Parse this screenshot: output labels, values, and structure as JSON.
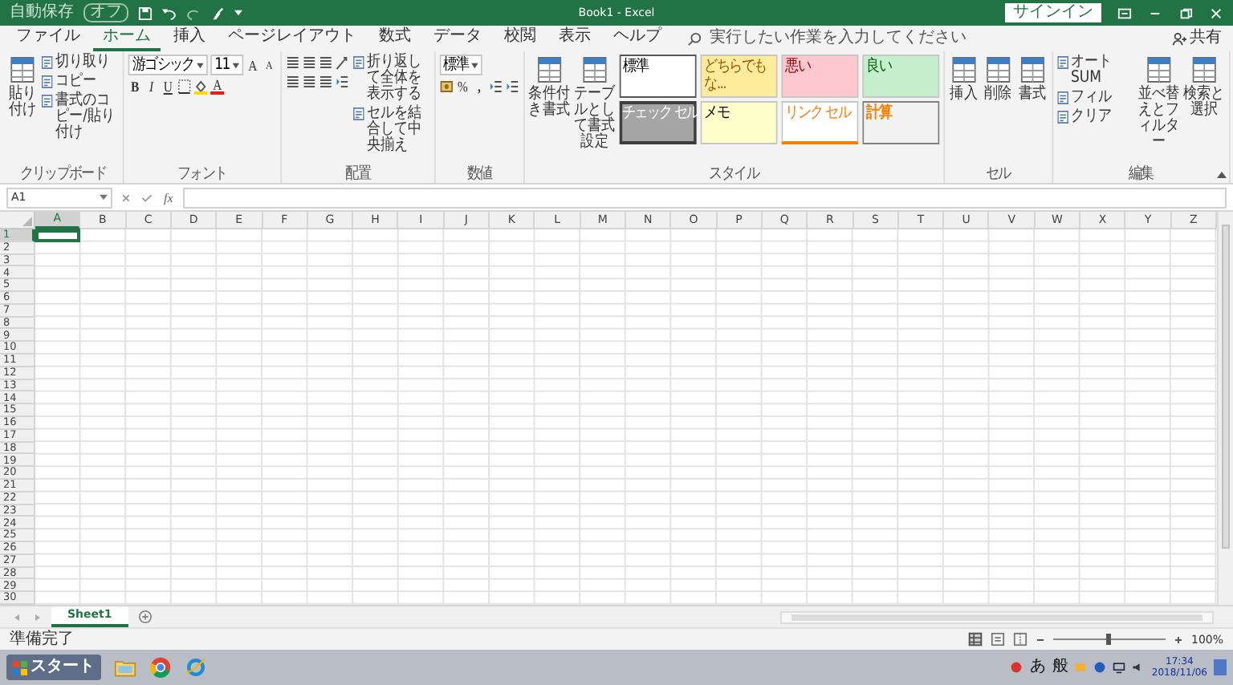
{
  "title_bar": {
    "autosave": "自動保存",
    "autosave_state": "オフ",
    "title": "Book1 - Excel",
    "signin": "サインイン"
  },
  "tabs": [
    {
      "label": "ファイル",
      "selected": false
    },
    {
      "label": "ホーム",
      "selected": true
    },
    {
      "label": "挿入",
      "selected": false
    },
    {
      "label": "ページレイアウト",
      "selected": false
    },
    {
      "label": "数式",
      "selected": false
    },
    {
      "label": "データ",
      "selected": false
    },
    {
      "label": "校閲",
      "selected": false
    },
    {
      "label": "表示",
      "selected": false
    },
    {
      "label": "ヘルプ",
      "selected": false
    }
  ],
  "tell_me": "実行したい作業を入力してください",
  "share": "共有",
  "ribbon": {
    "groups": [
      {
        "label": "クリップボード",
        "columns": [
          [
            [
              {
                "kind": "large",
                "label": "貼り付け"
              }
            ]
          ],
          [
            [
              {
                "kind": "small",
                "label": "切り取り"
              }
            ],
            [
              {
                "kind": "small",
                "label": "コピー"
              }
            ],
            [
              {
                "kind": "small",
                "label": "書式のコピー/貼り付け"
              }
            ]
          ]
        ]
      },
      {
        "label": "フォント",
        "columns": [
          [
            [
              {
                "kind": "field",
                "value": "游ゴシック"
              },
              {
                "kind": "field",
                "value": "11"
              },
              {
                "kind": "grow",
                "text": "A"
              },
              {
                "kind": "shrink",
                "text": "A"
              }
            ],
            [
              {
                "kind": "bold",
                "text": "B"
              },
              {
                "kind": "italic",
                "text": "I"
              },
              {
                "kind": "underline",
                "text": "U"
              },
              {
                "kind": "border"
              },
              {
                "kind": "fill"
              },
              {
                "kind": "fontcolor",
                "text": "A"
              }
            ]
          ]
        ]
      },
      {
        "label": "配置",
        "columns": [
          [
            [
              {
                "kind": "align"
              },
              {
                "kind": "align"
              },
              {
                "kind": "align"
              },
              {
                "kind": "orient"
              }
            ],
            [
              {
                "kind": "align"
              },
              {
                "kind": "align"
              },
              {
                "kind": "align"
              },
              {
                "kind": "indent"
              }
            ]
          ],
          [
            [
              {
                "kind": "small",
                "label": "折り返して全体を表示する"
              }
            ],
            [
              {
                "kind": "small",
                "label": "セルを結合して中央揃え"
              }
            ]
          ]
        ]
      },
      {
        "label": "数値",
        "columns": [
          [
            [
              {
                "kind": "field",
                "value": "標準"
              }
            ],
            [
              {
                "kind": "currency"
              },
              {
                "kind": "percent",
                "text": "%"
              },
              {
                "kind": "comma",
                "text": ","
              },
              {
                "kind": "indent"
              },
              {
                "kind": "indent"
              }
            ]
          ]
        ]
      },
      {
        "label": "スタイル",
        "columns": [
          [
            [
              {
                "kind": "large",
                "label": "条件付き書式"
              }
            ]
          ],
          [
            [
              {
                "kind": "large",
                "label": "テーブルとして書式設定"
              }
            ]
          ],
          [
            [
              {
                "kind": "normal",
                "label": "標準",
                "color": "#ffffff"
              }
            ],
            [
              {
                "kind": "check",
                "label": "チェック セル",
                "color": "#a5a5a5"
              }
            ]
          ],
          [
            [
              {
                "kind": "neutral",
                "label": "どちらでもな...",
                "color": "#ffeb9c"
              }
            ],
            [
              {
                "kind": "note",
                "label": "メモ",
                "color": "#ffffcc"
              }
            ]
          ],
          [
            [
              {
                "kind": "bad",
                "label": "悪い",
                "color": "#ffc7ce"
              }
            ],
            [
              {
                "kind": "link",
                "label": "リンク セル",
                "color": "#ffffff"
              }
            ]
          ],
          [
            [
              {
                "kind": "good",
                "label": "良い",
                "color": "#c6efce"
              }
            ],
            [
              {
                "kind": "calc",
                "label": "計算",
                "color": "#f2f2f2"
              }
            ]
          ]
        ]
      },
      {
        "label": "セル",
        "columns": [
          [
            [
              {
                "kind": "large",
                "label": "挿入"
              }
            ]
          ],
          [
            [
              {
                "kind": "large",
                "label": "削除"
              }
            ]
          ],
          [
            [
              {
                "kind": "large",
                "label": "書式"
              }
            ]
          ]
        ]
      },
      {
        "label": "編集",
        "columns": [
          [
            [
              {
                "kind": "small",
                "label": "オート SUM"
              }
            ],
            [
              {
                "kind": "small",
                "label": "フィル"
              }
            ],
            [
              {
                "kind": "small",
                "label": "クリア"
              }
            ]
          ],
          [
            [
              {
                "kind": "large",
                "label": "並べ替えとフィルター"
              }
            ]
          ],
          [
            [
              {
                "kind": "large",
                "label": "検索と選択"
              }
            ]
          ]
        ]
      }
    ]
  },
  "formula_bar": {
    "name_box": "A1",
    "function_label": "fx"
  },
  "columns": [
    {
      "label": "A",
      "selected": true
    },
    {
      "label": "B",
      "selected": false
    },
    {
      "label": "C",
      "selected": false
    },
    {
      "label": "D",
      "selected": false
    },
    {
      "label": "E",
      "selected": false
    },
    {
      "label": "F",
      "selected": false
    },
    {
      "label": "G",
      "selected": false
    },
    {
      "label": "H",
      "selected": false
    },
    {
      "label": "I",
      "selected": false
    },
    {
      "label": "J",
      "selected": false
    },
    {
      "label": "K",
      "selected": false
    },
    {
      "label": "L",
      "selected": false
    },
    {
      "label": "M",
      "selected": false
    },
    {
      "label": "N",
      "selected": false
    },
    {
      "label": "O",
      "selected": false
    },
    {
      "label": "P",
      "selected": false
    },
    {
      "label": "Q",
      "selected": false
    },
    {
      "label": "R",
      "selected": false
    },
    {
      "label": "S",
      "selected": false
    },
    {
      "label": "T",
      "selected": false
    },
    {
      "label": "U",
      "selected": false
    },
    {
      "label": "V",
      "selected": false
    },
    {
      "label": "W",
      "selected": false
    },
    {
      "label": "X",
      "selected": false
    },
    {
      "label": "Y",
      "selected": false
    },
    {
      "label": "Z",
      "selected": false
    }
  ],
  "rows": [
    {
      "label": "1",
      "selected": true
    },
    {
      "label": "2",
      "selected": false
    },
    {
      "label": "3",
      "selected": false
    },
    {
      "label": "4",
      "selected": false
    },
    {
      "label": "5",
      "selected": false
    },
    {
      "label": "6",
      "selected": false
    },
    {
      "label": "7",
      "selected": false
    },
    {
      "label": "8",
      "selected": false
    },
    {
      "label": "9",
      "selected": false
    },
    {
      "label": "10",
      "selected": false
    },
    {
      "label": "11",
      "selected": false
    },
    {
      "label": "12",
      "selected": false
    },
    {
      "label": "13",
      "selected": false
    },
    {
      "label": "14",
      "selected": false
    },
    {
      "label": "15",
      "selected": false
    },
    {
      "label": "16",
      "selected": false
    },
    {
      "label": "17",
      "selected": false
    },
    {
      "label": "18",
      "selected": false
    },
    {
      "label": "19",
      "selected": false
    },
    {
      "label": "20",
      "selected": false
    },
    {
      "label": "21",
      "selected": false
    },
    {
      "label": "22",
      "selected": false
    },
    {
      "label": "23",
      "selected": false
    },
    {
      "label": "24",
      "selected": false
    },
    {
      "label": "25",
      "selected": false
    },
    {
      "label": "26",
      "selected": false
    },
    {
      "label": "27",
      "selected": false
    },
    {
      "label": "28",
      "selected": false
    },
    {
      "label": "29",
      "selected": false
    },
    {
      "label": "30",
      "selected": false
    }
  ],
  "sheets": [
    {
      "label": "Sheet1",
      "selected": true
    }
  ],
  "status_bar": {
    "status": "準備完了",
    "zoom": {
      "level": 0.5,
      "reading": "100%"
    }
  },
  "taskbar": {
    "start": "スタート",
    "ime": "あ",
    "ime_mode": "般",
    "time": "17:34",
    "date": "2018/11/06"
  }
}
